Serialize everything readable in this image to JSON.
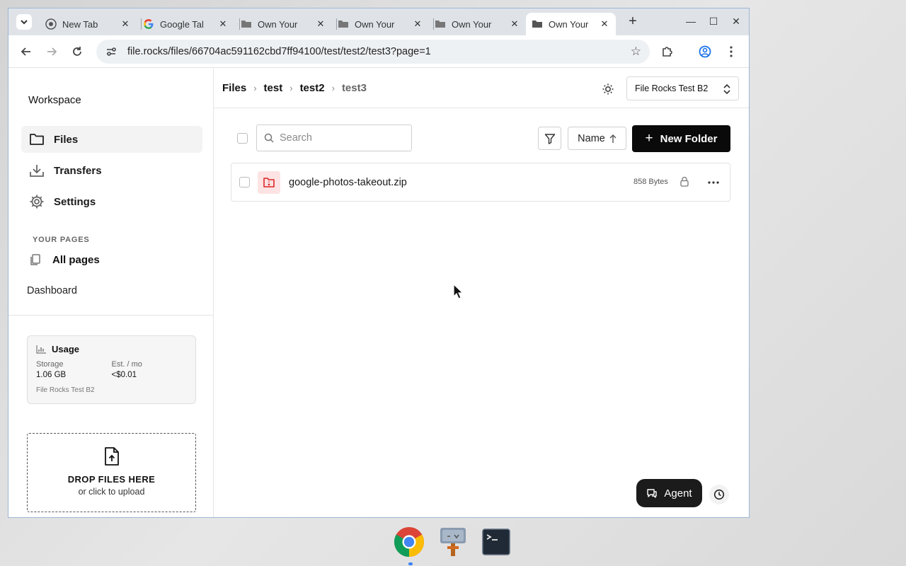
{
  "browser": {
    "tabs": [
      {
        "title": "New Tab",
        "icon": "chrome-icon",
        "active": false
      },
      {
        "title": "Google Tal",
        "icon": "google-icon",
        "active": false
      },
      {
        "title": "Own Your",
        "icon": "filerocks-icon",
        "active": false
      },
      {
        "title": "Own Your",
        "icon": "filerocks-icon",
        "active": false
      },
      {
        "title": "Own Your",
        "icon": "filerocks-icon",
        "active": false
      },
      {
        "title": "Own Your",
        "icon": "filerocks-icon",
        "active": true
      }
    ],
    "url": "file.rocks/files/66704ac591162cbd7ff94100/test/test2/test3?page=1"
  },
  "sidebar": {
    "workspace_label": "Workspace",
    "nav": [
      {
        "label": "Files",
        "icon": "folder-icon",
        "active": true
      },
      {
        "label": "Transfers",
        "icon": "download-icon",
        "active": false
      },
      {
        "label": "Settings",
        "icon": "gear-icon",
        "active": false
      }
    ],
    "pages_section_label": "YOUR PAGES",
    "all_pages_label": "All pages",
    "dashboard_label": "Dashboard",
    "usage": {
      "title": "Usage",
      "storage_label": "Storage",
      "storage_value": "1.06 GB",
      "cost_label": "Est. / mo",
      "cost_value": "<$0.01",
      "bucket_name": "File Rocks Test B2"
    },
    "dropzone": {
      "title": "DROP FILES HERE",
      "subtitle": "or click to upload"
    }
  },
  "header": {
    "breadcrumb": [
      "Files",
      "test",
      "test2",
      "test3"
    ],
    "bucket_select_value": "File Rocks Test B2"
  },
  "toolbar": {
    "search_placeholder": "Search",
    "sort_label": "Name",
    "new_folder_label": "New Folder"
  },
  "files": [
    {
      "name": "google-photos-takeout.zip",
      "size": "858 Bytes",
      "icon": "zip-file-icon",
      "locked": true
    }
  ],
  "floating": {
    "agent_label": "Agent"
  },
  "colors": {
    "accent": "#0a0a0a",
    "file_icon_bg": "#fde3e3",
    "file_icon_fg": "#dc2626"
  }
}
